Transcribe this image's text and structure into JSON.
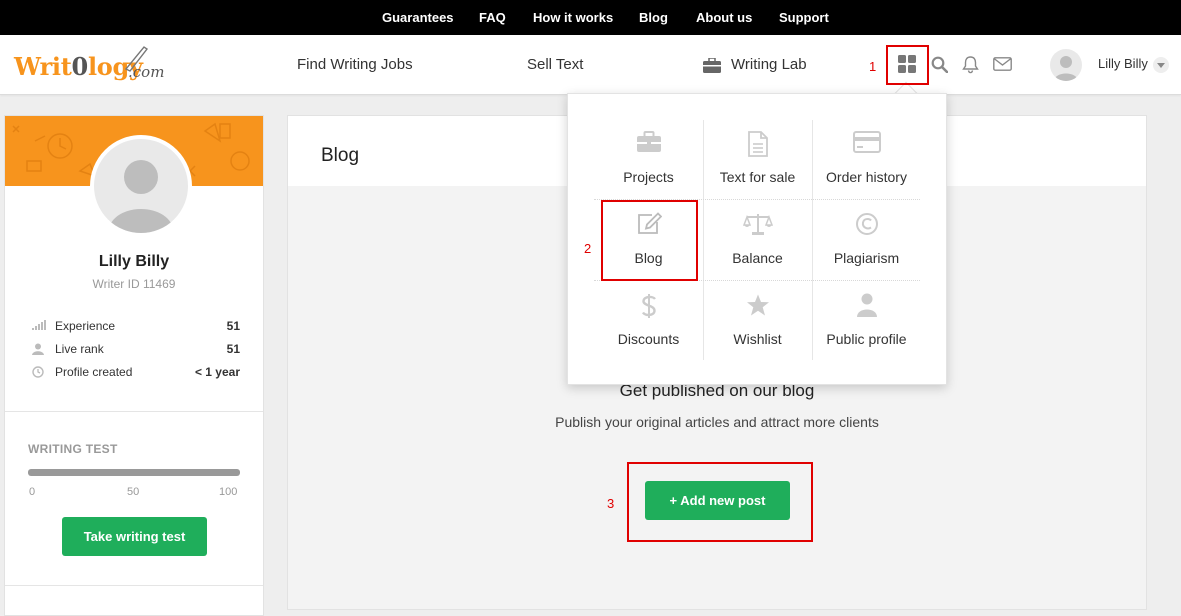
{
  "top_nav": {
    "links": [
      "Guarantees",
      "FAQ",
      "How it works",
      "Blog",
      "About us",
      "Support"
    ]
  },
  "header": {
    "logo": {
      "text_a": "Writ",
      "text_b": "0",
      "text_c": "logy",
      "suffix": ".com"
    },
    "nav": [
      "Find Writing Jobs",
      "Sell Text",
      "Writing Lab"
    ],
    "icons": [
      "apps-grid-icon",
      "search-icon",
      "bell-icon",
      "mail-icon"
    ],
    "user_name": "Lilly Billy"
  },
  "annotations": {
    "one": "1",
    "two": "2",
    "three": "3"
  },
  "sidebar": {
    "name": "Lilly Billy",
    "writer_id": "Writer ID 11469",
    "stats": [
      {
        "label": "Experience",
        "value": "51",
        "icon": "bars-icon"
      },
      {
        "label": "Live rank",
        "value": "51",
        "icon": "user-icon"
      },
      {
        "label": "Profile created",
        "value": "< 1 year",
        "icon": "clock-icon"
      }
    ],
    "writing_test": {
      "label": "WRITING TEST",
      "ticks": [
        "0",
        "50",
        "100"
      ],
      "button": "Take writing test"
    }
  },
  "main": {
    "title": "Blog",
    "heading": "Get published on our blog",
    "subheading": "Publish your original articles and attract more clients",
    "button": "+ Add new post"
  },
  "dropdown": {
    "items": [
      {
        "label": "Projects",
        "icon": "briefcase-icon"
      },
      {
        "label": "Text for sale",
        "icon": "document-icon"
      },
      {
        "label": "Order history",
        "icon": "credit-card-icon"
      },
      {
        "label": "Blog",
        "icon": "edit-icon"
      },
      {
        "label": "Balance",
        "icon": "scale-icon"
      },
      {
        "label": "Plagiarism",
        "icon": "copyright-icon"
      },
      {
        "label": "Discounts",
        "icon": "dollar-icon"
      },
      {
        "label": "Wishlist",
        "icon": "star-icon"
      },
      {
        "label": "Public profile",
        "icon": "user-icon"
      }
    ]
  },
  "colors": {
    "brand_orange": "#f7941d",
    "green": "#1fae5b",
    "annotation_red": "#e00000"
  }
}
